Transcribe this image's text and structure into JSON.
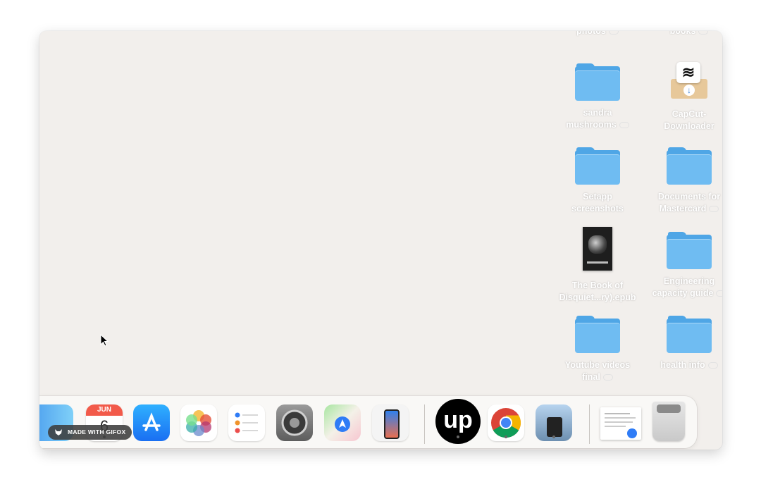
{
  "desktop": {
    "items": [
      {
        "label_lines": [
          "photos"
        ],
        "cloud": true,
        "kind": "folder-cut"
      },
      {
        "label_lines": [
          "books"
        ],
        "cloud": true,
        "kind": "folder-cut"
      },
      {
        "label_lines": [
          "sandra",
          "mushrooms"
        ],
        "cloud": true,
        "kind": "folder"
      },
      {
        "label_lines": [
          "CapCut-",
          "Downloader"
        ],
        "cloud": false,
        "kind": "installer"
      },
      {
        "label_lines": [
          "Setapp",
          "screenshots"
        ],
        "cloud": false,
        "kind": "folder"
      },
      {
        "label_lines": [
          "Documents for",
          "Mastercard"
        ],
        "cloud": true,
        "kind": "folder"
      },
      {
        "label_lines": [
          "The Book of",
          "Disquiet...ry).epub"
        ],
        "cloud": false,
        "kind": "book"
      },
      {
        "label_lines": [
          "Engineering",
          "capacity guide"
        ],
        "cloud": true,
        "kind": "folder"
      },
      {
        "label_lines": [
          "Youtube videos",
          "final"
        ],
        "cloud": true,
        "kind": "folder"
      },
      {
        "label_lines": [
          "health info"
        ],
        "cloud": true,
        "kind": "folder"
      }
    ]
  },
  "dock": {
    "calendar": {
      "month": "JUN",
      "day": "6"
    },
    "apps": [
      "finder-icon",
      "calendar-icon",
      "app-store-icon",
      "photos-icon",
      "reminders-icon",
      "system-settings-icon",
      "maps-icon",
      "iphone-mirroring-icon",
      "upwork-icon",
      "chrome-icon",
      "preview-icon",
      "document-stack-icon",
      "trash-icon"
    ],
    "upwork_text": "up"
  },
  "watermark": {
    "text": "MADE WITH GIFOX"
  }
}
